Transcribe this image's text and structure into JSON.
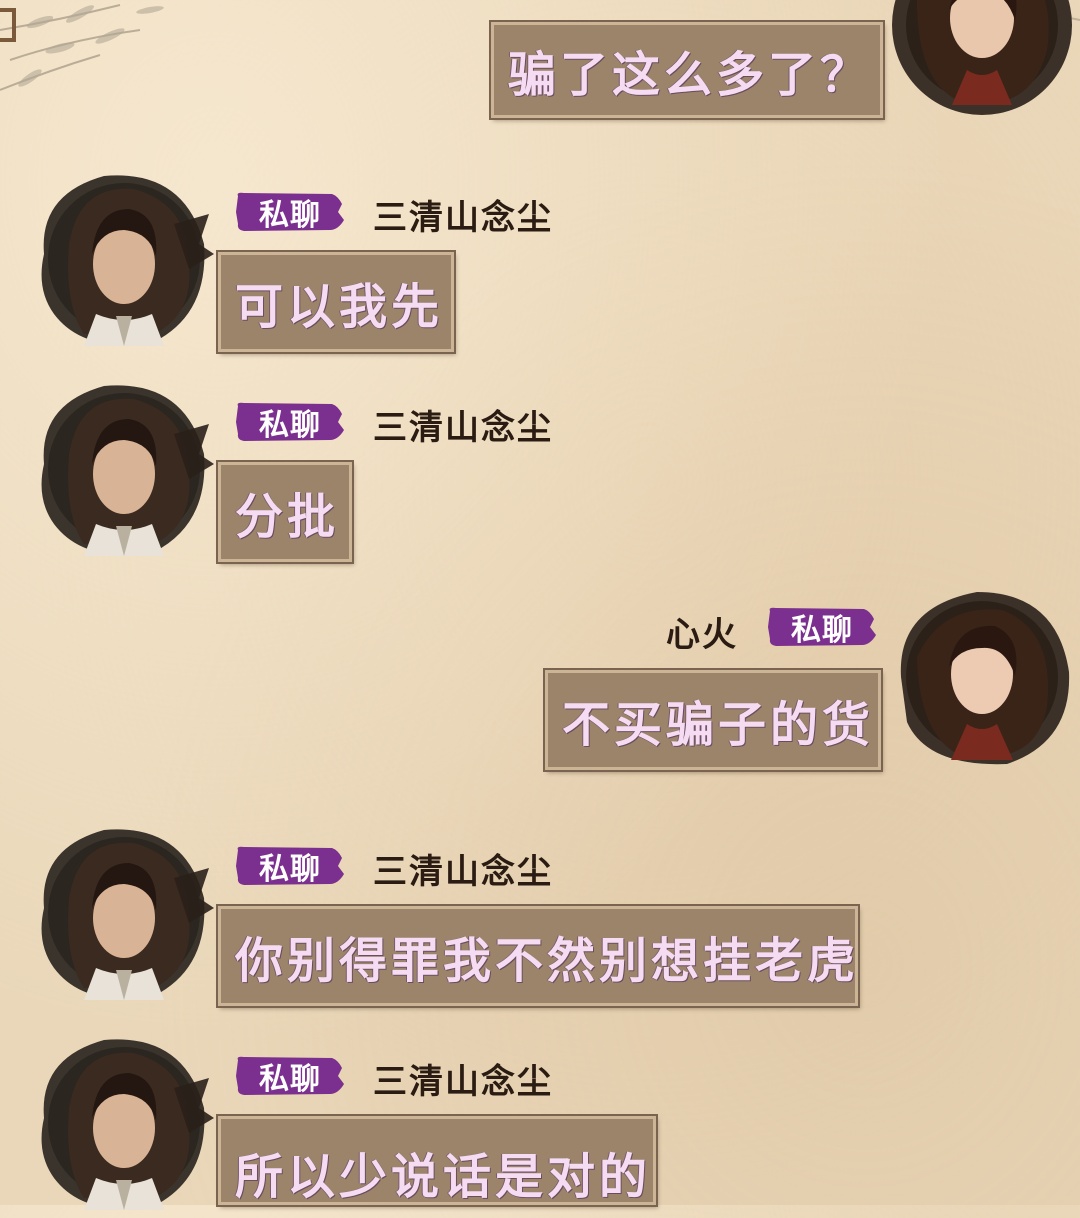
{
  "colors": {
    "paper": "#ead7b9",
    "bubble": "#9b846a",
    "bubble_text": "#f6dcf3",
    "private_tag": "#7b2f8e",
    "name_text": "#2a1c12"
  },
  "icons": {
    "male_avatar": "male-avatar-icon",
    "female_avatar": "female-avatar-icon",
    "private_tag": "private-chat-badge"
  },
  "messages": [
    {
      "side": "right",
      "sender": "",
      "tag": "",
      "text": "骗了这么多了？"
    },
    {
      "side": "left",
      "sender": "三清山念尘",
      "tag": "私聊",
      "text": "可以我先"
    },
    {
      "side": "left",
      "sender": "三清山念尘",
      "tag": "私聊",
      "text": "分批"
    },
    {
      "side": "right",
      "sender": "心火",
      "tag": "私聊",
      "text": "不买骗子的货"
    },
    {
      "side": "left",
      "sender": "三清山念尘",
      "tag": "私聊",
      "text": "你别得罪我不然别想挂老虎"
    },
    {
      "side": "left",
      "sender": "三清山念尘",
      "tag": "私聊",
      "text": "所以少说话是对的"
    }
  ]
}
